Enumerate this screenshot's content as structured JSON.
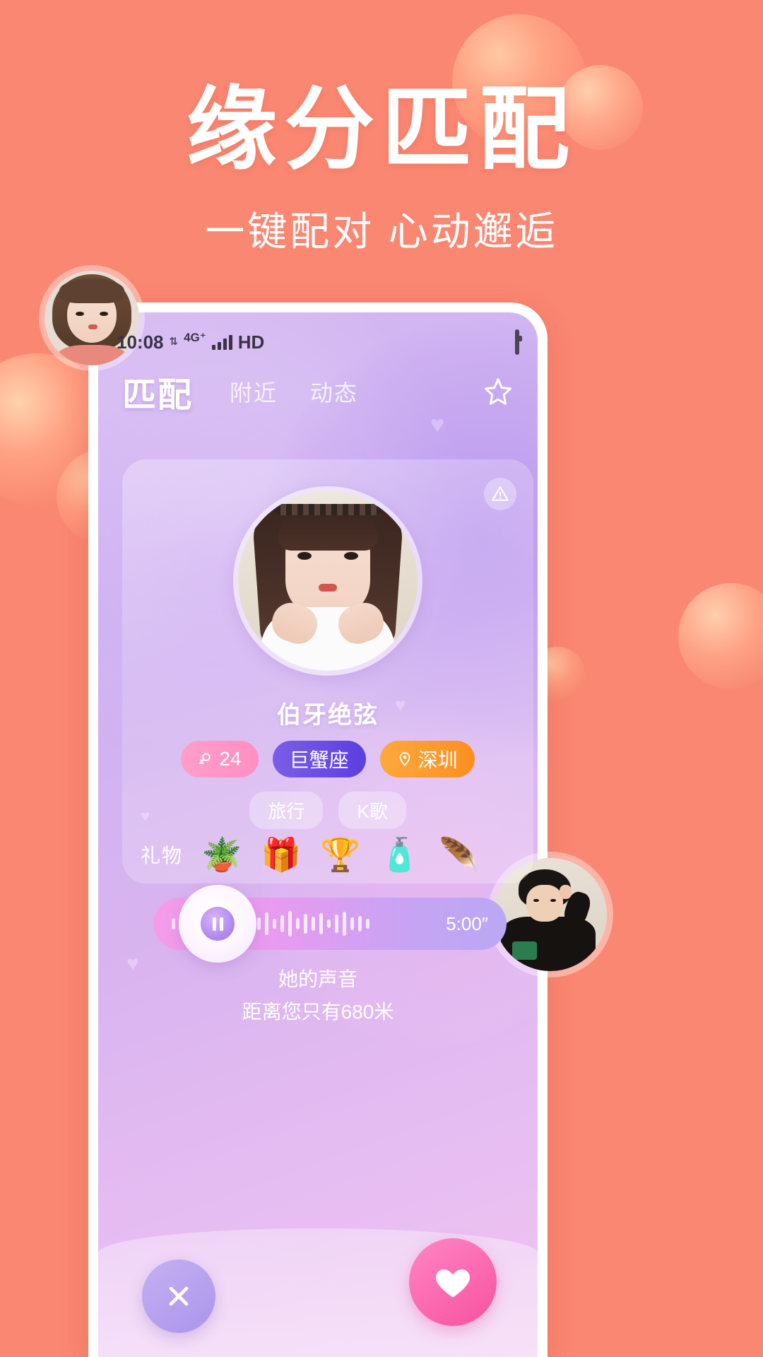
{
  "promo": {
    "headline": "缘分匹配",
    "subhead": "一键配对 心动邂逅"
  },
  "colors": {
    "background": "#fa8772",
    "accent_pink": "#ff8fc2",
    "accent_purple": "#5b3fe0",
    "accent_orange": "#fb8f21",
    "like_button": "#f8519f"
  },
  "phone": {
    "statusbar": {
      "time": "10:08",
      "network": "4G",
      "network_plus": "+",
      "hd_label": "HD"
    },
    "navbar": {
      "active_tab": "匹配",
      "tabs": [
        "附近",
        "动态"
      ],
      "star_icon": "star-icon"
    },
    "profile": {
      "name": "伯牙绝弦",
      "warning_icon": "warning-icon",
      "pills": [
        {
          "icon": "female-icon",
          "label": "24",
          "type": "age"
        },
        {
          "icon": "",
          "label": "巨蟹座",
          "type": "zodiac"
        },
        {
          "icon": "location-icon",
          "label": "深圳",
          "type": "city"
        }
      ],
      "interest_tags": [
        "旅行",
        "K歌"
      ],
      "gifts_label": "礼物",
      "gifts": [
        {
          "name": "succulent-plant-gift",
          "glyph": "🪴"
        },
        {
          "name": "music-box-gift",
          "glyph": "🎁"
        },
        {
          "name": "crown-trophy-gift",
          "glyph": "🏆"
        },
        {
          "name": "perfume-bottle-gift",
          "glyph": "🧴"
        },
        {
          "name": "feather-quill-gift",
          "glyph": "🪶"
        }
      ]
    },
    "voice": {
      "duration": "5:00″",
      "play_state": "pause-icon",
      "caption": "她的声音",
      "distance": "距离您只有680米"
    },
    "actions": {
      "pass_icon": "close-icon",
      "like_icon": "heart-icon"
    }
  },
  "floating_avatars": [
    {
      "name": "girl-avatar-top-left"
    },
    {
      "name": "boy-avatar-bottom-right"
    }
  ]
}
